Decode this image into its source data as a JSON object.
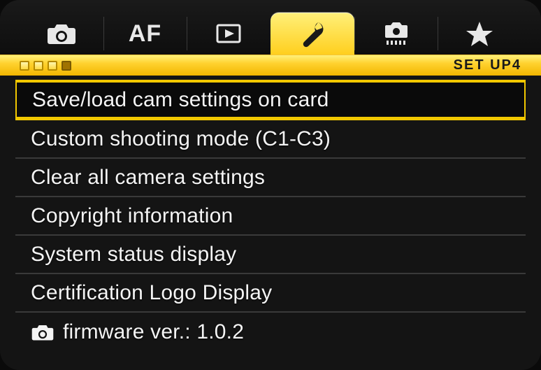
{
  "colors": {
    "accent": "#f2c800",
    "text": "#f4f4f4"
  },
  "tabs": {
    "activeIndex": 3,
    "items": [
      {
        "icon": "camera-icon"
      },
      {
        "icon": "af-icon",
        "label": "AF"
      },
      {
        "icon": "playback-icon"
      },
      {
        "icon": "wrench-icon"
      },
      {
        "icon": "custom-fn-icon"
      },
      {
        "icon": "star-icon"
      }
    ]
  },
  "subpage": {
    "total": 4,
    "current": 4,
    "label": "SET UP4"
  },
  "menu": {
    "selectedIndex": 0,
    "items": [
      {
        "label": "Save/load cam settings on card"
      },
      {
        "label": "Custom shooting mode (C1-C3)"
      },
      {
        "label": "Clear all camera settings"
      },
      {
        "label": "Copyright information"
      },
      {
        "label": "System status display"
      },
      {
        "label": "Certification Logo Display"
      },
      {
        "label": "firmware ver.: 1.0.2",
        "icon": "camera-icon"
      }
    ]
  }
}
